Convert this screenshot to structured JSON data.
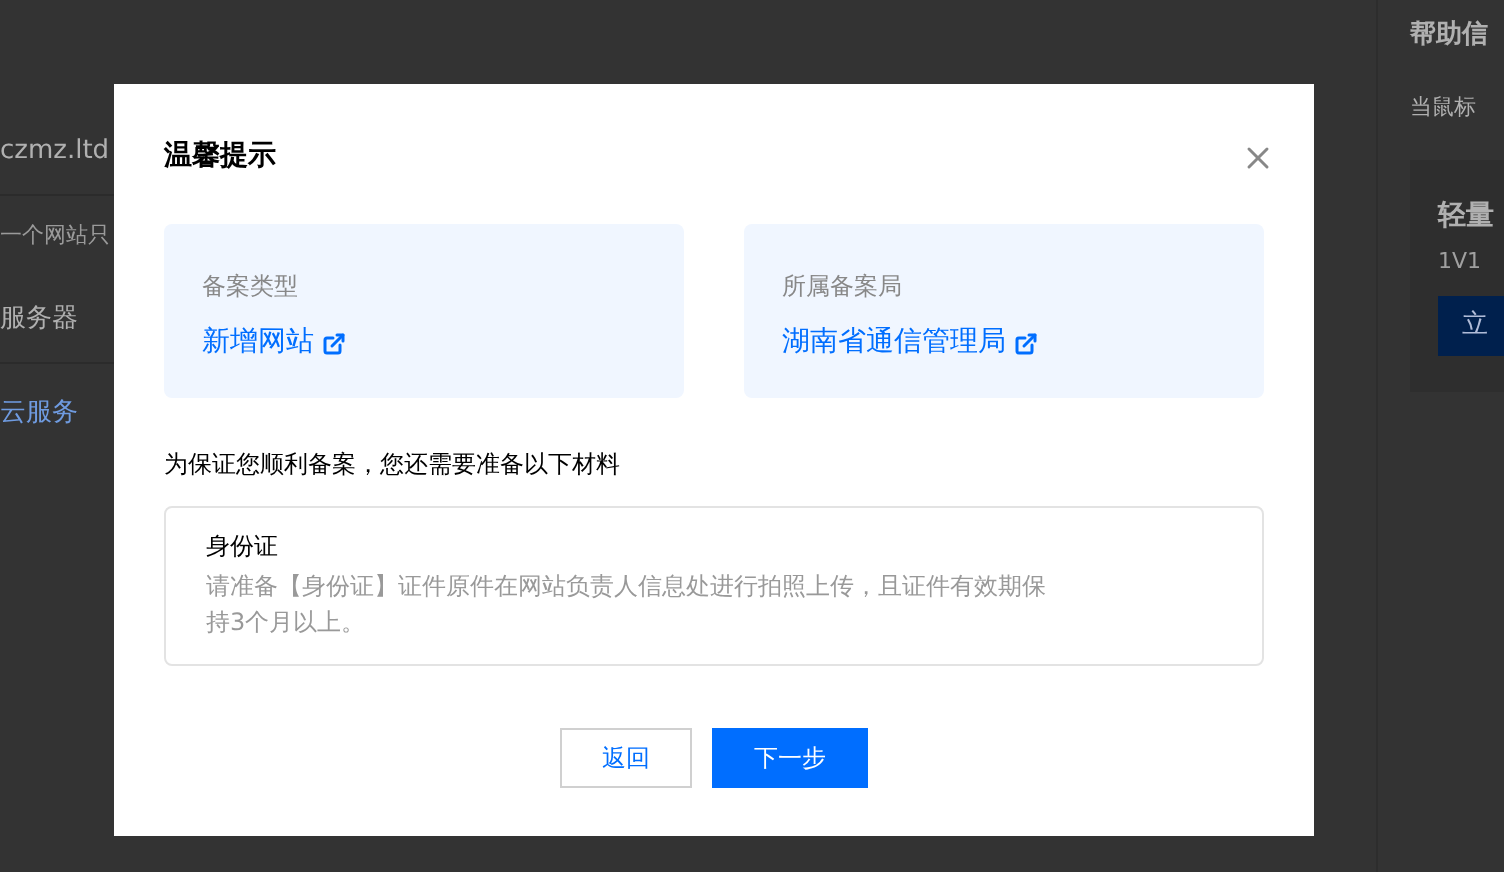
{
  "background": {
    "left_items": [
      {
        "text": "czmz.ltd",
        "kind": "value"
      },
      {
        "text": "一个网站只",
        "kind": "hint"
      },
      {
        "text": "服务器",
        "kind": "value"
      },
      {
        "text": "云服务",
        "kind": "link"
      }
    ],
    "help": {
      "title": "帮助信",
      "hint": "当鼠标",
      "card": {
        "title": "轻量",
        "subtitle": "1V1",
        "button": "立"
      }
    }
  },
  "modal": {
    "title": "温馨提示",
    "info_cards": [
      {
        "label": "备案类型",
        "link": "新增网站"
      },
      {
        "label": "所属备案局",
        "link": "湖南省通信管理局"
      }
    ],
    "notice": "为保证您顺利备案，您还需要准备以下材料",
    "materials": [
      {
        "title": "身份证",
        "description": "请准备【身份证】证件原件在网站负责人信息处进行拍照上传，且证件有效期保持3个月以上。"
      }
    ],
    "buttons": [
      {
        "label": "返回",
        "kind": "secondary"
      },
      {
        "label": "下一步",
        "kind": "primary"
      }
    ]
  }
}
